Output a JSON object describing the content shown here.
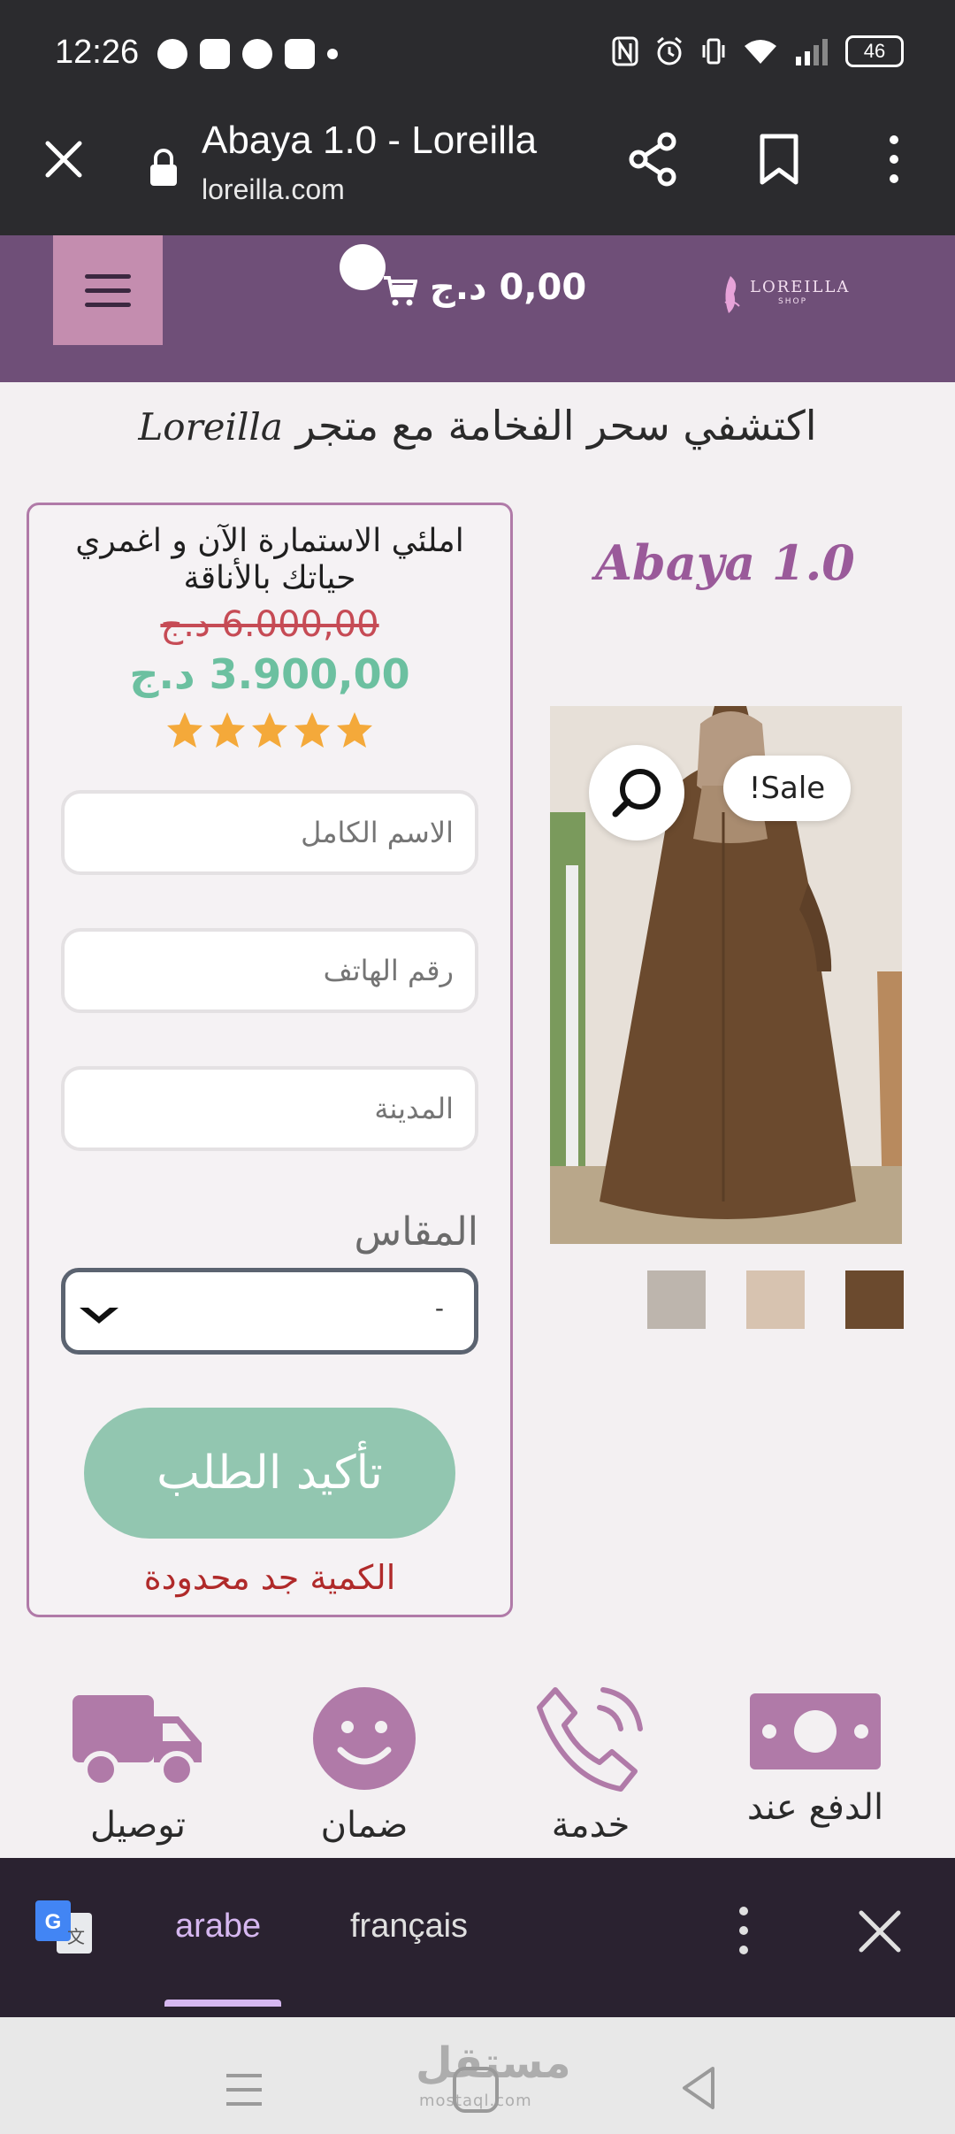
{
  "status_bar": {
    "time": "12:26",
    "battery": "46"
  },
  "browser": {
    "title": "Abaya 1.0 - Loreilla",
    "url": "loreilla.com"
  },
  "header": {
    "cart_total": "0,00 د.ج",
    "logo_text": "LOREILLA",
    "logo_sub": "SHOP"
  },
  "tagline": {
    "arabic": "اكتشفي سحر الفخامة مع متجر",
    "brand": "Loreilla"
  },
  "product": {
    "title": "Abaya 1.0",
    "sale_badge": "!Sale"
  },
  "order_form": {
    "headline": "املئي الاستمارة الآن و اغمري حياتك بالأناقة",
    "old_price": "6.000,00 د.ج",
    "new_price": "3.900,00 د.ج",
    "rating": 5,
    "fields": {
      "name_placeholder": "الاسم الكامل",
      "phone_placeholder": "رقم الهاتف",
      "city_placeholder": "المدينة"
    },
    "size_label": "المقاس",
    "size_selected": "-",
    "confirm_label": "تأكيد الطلب",
    "limited_text": "الكمية جد محدودة"
  },
  "features": [
    {
      "label": "الدفع عند",
      "icon": "money-icon"
    },
    {
      "label": "خدمة",
      "icon": "phone-icon"
    },
    {
      "label": "ضمان",
      "icon": "smile-icon"
    },
    {
      "label": "توصيل",
      "icon": "truck-icon"
    }
  ],
  "translate_bar": {
    "lang_active": "arabe",
    "lang_other": "français"
  },
  "watermark": {
    "text": "مستقل",
    "sub": "mostaql.com"
  },
  "colors": {
    "header_bg": "#6f4f78",
    "accent_purple": "#9a5a9a",
    "price_green": "#6cc0a0",
    "price_red": "#c64b55",
    "confirm_green": "#92c6b0",
    "star": "#f4a93a"
  }
}
